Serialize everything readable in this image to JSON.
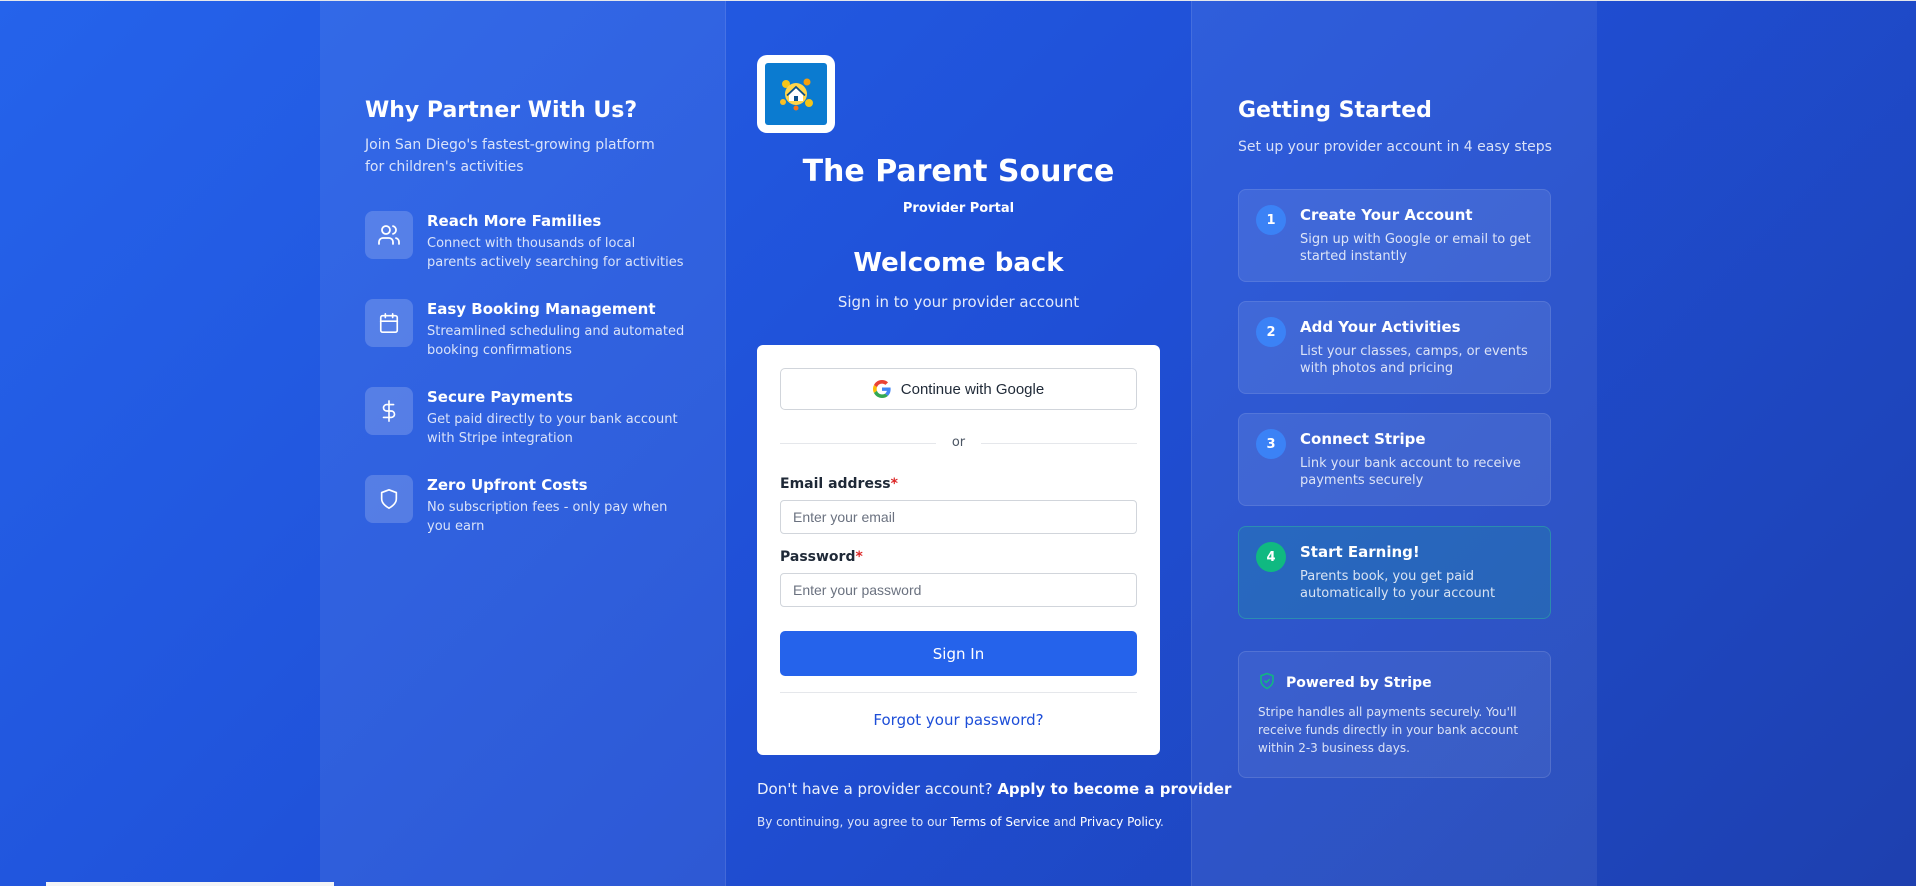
{
  "left": {
    "title": "Why Partner With Us?",
    "subtitle": "Join San Diego's fastest-growing platform for children's activities",
    "benefits": [
      {
        "title": "Reach More Families",
        "desc": "Connect with thousands of local parents actively searching for activities",
        "icon": "users-icon"
      },
      {
        "title": "Easy Booking Management",
        "desc": "Streamlined scheduling and automated booking confirmations",
        "icon": "calendar-icon"
      },
      {
        "title": "Secure Payments",
        "desc": "Get paid directly to your bank account with Stripe integration",
        "icon": "dollar-icon"
      },
      {
        "title": "Zero Upfront Costs",
        "desc": "No subscription fees - only pay when you earn",
        "icon": "shield-icon"
      }
    ]
  },
  "center": {
    "brand_title": "The Parent Source",
    "brand_subtitle": "Provider Portal",
    "welcome": "Welcome back",
    "welcome_sub": "Sign in to your provider account",
    "google_label": "Continue with Google",
    "or_label": "or",
    "email_label": "Email address",
    "email_placeholder": "Enter your email",
    "password_label": "Password",
    "password_placeholder": "Enter your password",
    "required_mark": "*",
    "signin_label": "Sign In",
    "forgot_label": "Forgot your password?",
    "no_account_text": "Don't have a provider account?",
    "apply_link": "Apply to become a provider",
    "terms_prefix": "By continuing, you agree to our",
    "terms_link": "Terms of Service",
    "terms_and": "and",
    "privacy_link": "Privacy Policy",
    "terms_suffix": "."
  },
  "right": {
    "title": "Getting Started",
    "subtitle": "Set up your provider account in 4 easy steps",
    "steps": [
      {
        "num": "1",
        "title": "Create Your Account",
        "desc": "Sign up with Google or email to get started instantly"
      },
      {
        "num": "2",
        "title": "Add Your Activities",
        "desc": "List your classes, camps, or events with photos and pricing"
      },
      {
        "num": "3",
        "title": "Connect Stripe",
        "desc": "Link your bank account to receive payments securely"
      },
      {
        "num": "4",
        "title": "Start Earning!",
        "desc": "Parents book, you get paid automatically to your account"
      }
    ],
    "stripe_title": "Powered by Stripe",
    "stripe_desc": "Stripe handles all payments securely. You'll receive funds directly in your bank account within 2-3 business days."
  },
  "colors": {
    "background": "#2563eb",
    "primary_button": "#2563eb",
    "link": "#1d4ed8",
    "required": "#dc2626",
    "step_badge": "#3b82f6",
    "step_badge_active": "#10b981"
  }
}
